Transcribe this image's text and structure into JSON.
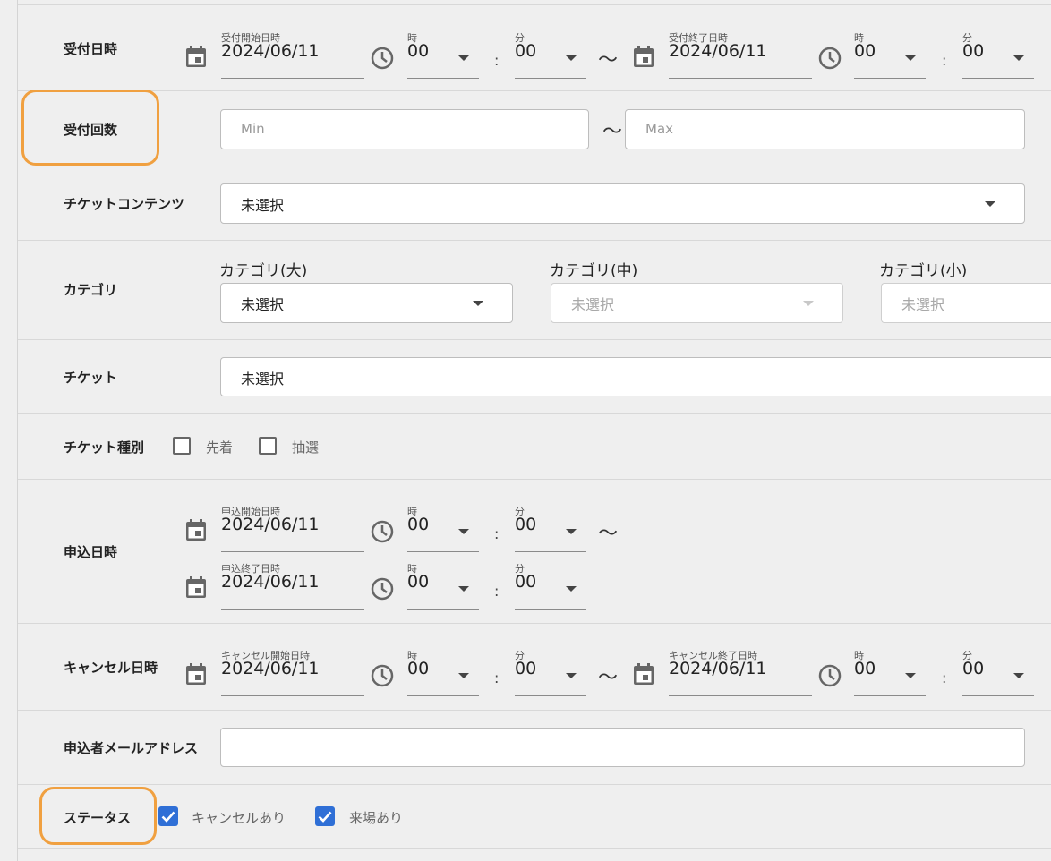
{
  "accept_datetime": {
    "label": "受付日時",
    "start_caption": "受付開始日時",
    "start_date": "2024/06/11",
    "end_caption": "受付終了日時",
    "end_date": "2024/06/11"
  },
  "time": {
    "hour_caption": "時",
    "minute_caption": "分",
    "hour_value": "00",
    "minute_value": "00",
    "colon": ":",
    "range": "〜"
  },
  "accept_count": {
    "label": "受付回数",
    "min_placeholder": "Min",
    "max_placeholder": "Max"
  },
  "ticket_contents": {
    "label": "チケットコンテンツ",
    "value": "未選択"
  },
  "category": {
    "label": "カテゴリ",
    "large_label": "カテゴリ(大)",
    "large_value": "未選択",
    "medium_label": "カテゴリ(中)",
    "medium_value": "未選択",
    "small_label": "カテゴリ(小)",
    "small_value": "未選択"
  },
  "ticket": {
    "label": "チケット",
    "value": "未選択"
  },
  "ticket_type": {
    "label": "チケット種別",
    "options": [
      {
        "label": "先着",
        "checked": false
      },
      {
        "label": "抽選",
        "checked": false
      }
    ]
  },
  "apply_datetime": {
    "label": "申込日時",
    "start_caption": "申込開始日時",
    "start_date": "2024/06/11",
    "end_caption": "申込終了日時",
    "end_date": "2024/06/11"
  },
  "cancel_datetime": {
    "label": "キャンセル日時",
    "start_caption": "キャンセル開始日時",
    "start_date": "2024/06/11",
    "end_caption": "キャンセル終了日時",
    "end_date": "2024/06/11"
  },
  "applicant_email": {
    "label": "申込者メールアドレス",
    "value": ""
  },
  "status": {
    "label": "ステータス",
    "options": [
      {
        "label": "キャンセルあり",
        "checked": true
      },
      {
        "label": "来場あり",
        "checked": true
      }
    ]
  },
  "colors": {
    "highlight": "#f0a040",
    "checkbox_checked": "#2f6fd6"
  }
}
